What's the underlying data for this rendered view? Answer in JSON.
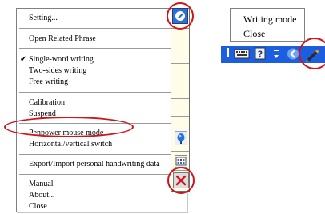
{
  "context_menu": {
    "items": [
      {
        "label": "Setting..."
      },
      {
        "label": "Open Related Phrase"
      },
      {
        "label": "Single-word writing",
        "checked": true
      },
      {
        "label": "Two-sides writing"
      },
      {
        "label": "Free writing"
      },
      {
        "label": "Calibration"
      },
      {
        "label": "Suspend"
      },
      {
        "label": "Penpower mouse mode"
      },
      {
        "label": "Horizontal/vertical switch"
      },
      {
        "label": "Export/Import personal handwriting data"
      },
      {
        "label": "Manual"
      },
      {
        "label": "About..."
      },
      {
        "label": "Close"
      }
    ],
    "check_glyph": "✔"
  },
  "tray_menu": {
    "items": [
      {
        "label": "Writing mode"
      },
      {
        "label": "Close"
      }
    ]
  },
  "taskbar": {
    "icons": [
      "keyboard-icon",
      "help-icon",
      "pen-tray-icon"
    ]
  },
  "colors": {
    "highlight_ring": "#d2131a",
    "taskbar": "#1b5fe0",
    "pad_button": "#2e6fd6"
  }
}
